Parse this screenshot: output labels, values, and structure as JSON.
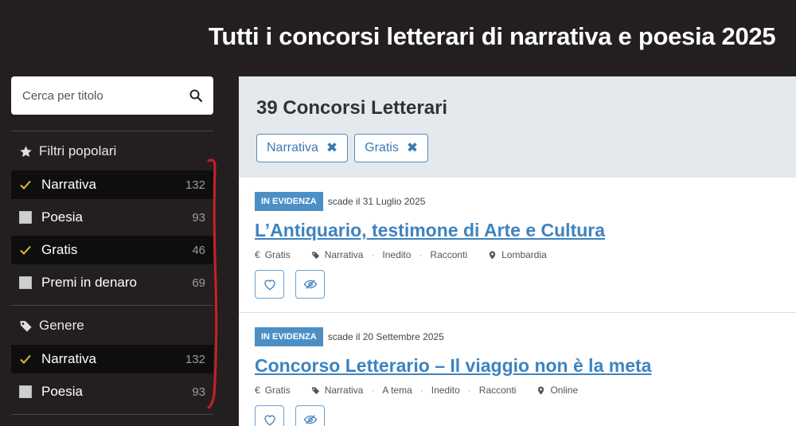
{
  "header": {
    "title": "Tutti i concorsi letterari di narrativa e poesia 2025"
  },
  "search": {
    "placeholder": "Cerca per titolo"
  },
  "popular": {
    "heading": "Filtri popolari",
    "items": [
      {
        "label": "Narrativa",
        "count": "132",
        "checked": true
      },
      {
        "label": "Poesia",
        "count": "93",
        "checked": false
      },
      {
        "label": "Gratis",
        "count": "46",
        "checked": true
      },
      {
        "label": "Premi in denaro",
        "count": "69",
        "checked": false
      }
    ]
  },
  "genre": {
    "heading": "Genere",
    "items": [
      {
        "label": "Narrativa",
        "count": "132",
        "checked": true
      },
      {
        "label": "Poesia",
        "count": "93",
        "checked": false
      }
    ]
  },
  "results": {
    "count_label": "39 Concorsi Letterari",
    "chips": [
      {
        "label": "Narrativa"
      },
      {
        "label": "Gratis"
      }
    ]
  },
  "cards": [
    {
      "badge": "In evidenza",
      "deadline": "scade il 31 Luglio 2025",
      "title": "L’Antiquario, testimone di Arte e Cultura",
      "fee": "Gratis",
      "tags": [
        "Narrativa",
        "Inedito",
        "Racconti"
      ],
      "location": "Lombardia"
    },
    {
      "badge": "In evidenza",
      "deadline": "scade il 20 Settembre 2025",
      "title": "Concorso Letterario – Il viaggio non è la meta",
      "fee": "Gratis",
      "tags": [
        "Narrativa",
        "A tema",
        "Inedito",
        "Racconti"
      ],
      "location": "Online"
    }
  ],
  "colors": {
    "accent": "#3e83bf",
    "checkmark": "#e8b931",
    "annotation": "#c8202a"
  }
}
